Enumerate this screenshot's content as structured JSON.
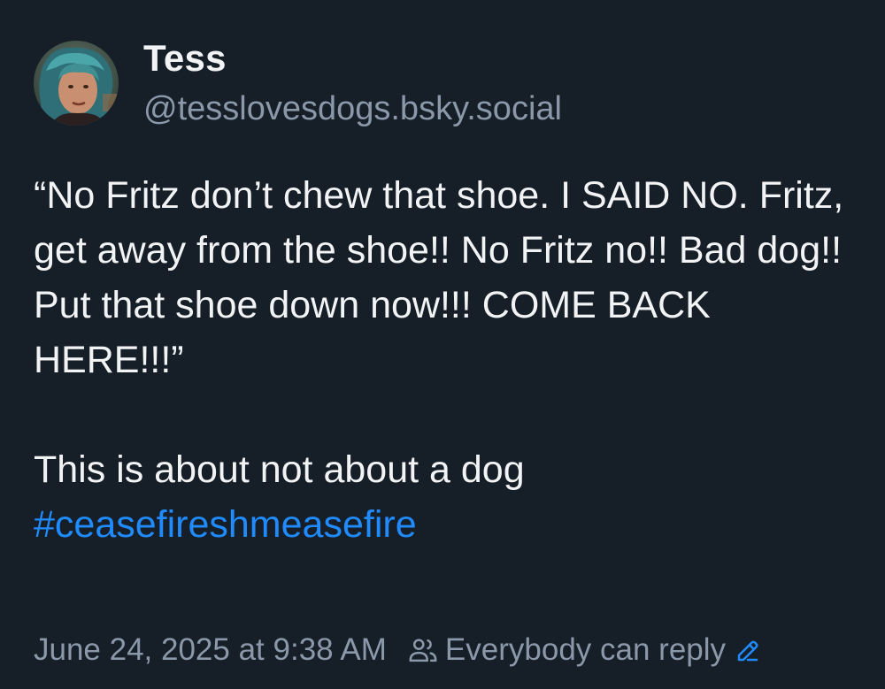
{
  "author": {
    "display_name": "Tess",
    "handle": "@tesslovesdogs.bsky.social",
    "avatar_icon": "user-avatar"
  },
  "post": {
    "paragraph1": "“No Fritz don’t chew that shoe. I SAID NO. Fritz, get away from the shoe!! No Fritz no!! Bad dog!! Put that shoe down now!!! COME BACK HERE!!!”",
    "paragraph2": "This is about not about a dog",
    "hashtag": "#ceasefireshmeasefire"
  },
  "footer": {
    "timestamp": "June 24, 2025 at 9:38 AM",
    "reply_setting": "Everybody can reply",
    "people_icon": "people-icon",
    "edit_icon": "pencil-icon"
  },
  "colors": {
    "background": "#161e27",
    "text": "#f1f3f5",
    "muted": "#8b98a9",
    "link": "#208bfe"
  }
}
